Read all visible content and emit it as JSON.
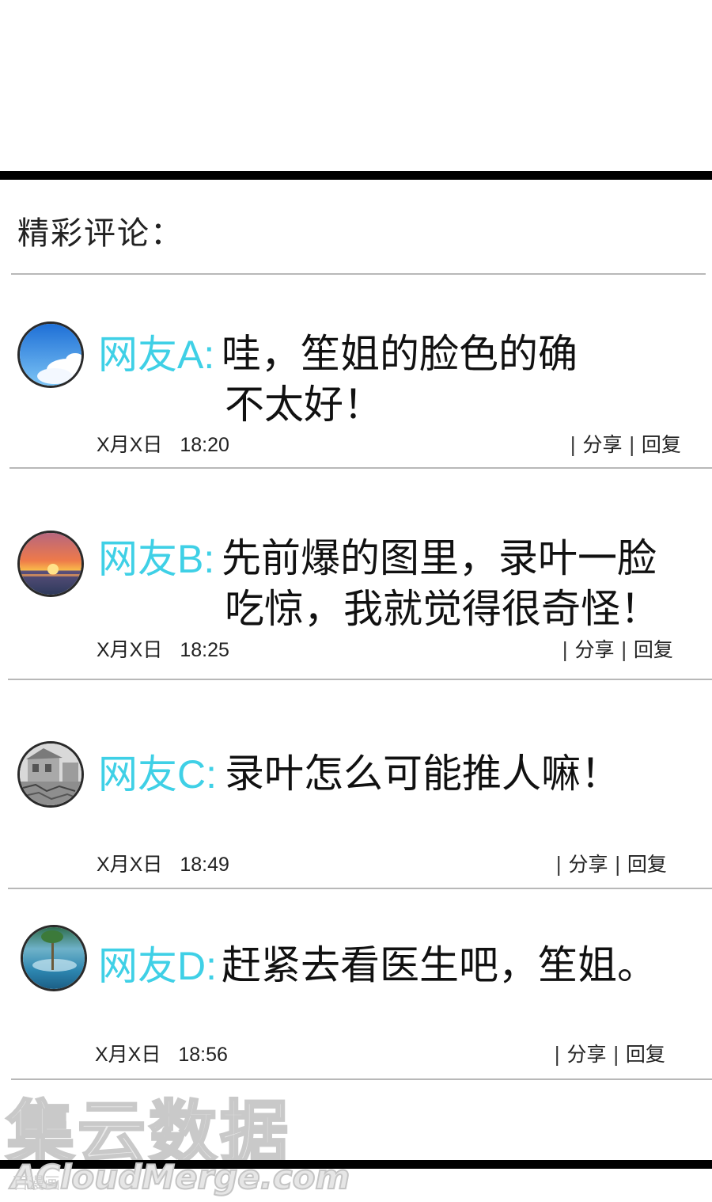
{
  "section_title": "精彩评论：",
  "comments": [
    {
      "user": "网友A:",
      "text_line1": "哇，笙姐的脸色的确",
      "text_line2": "不太好！",
      "date": "X月X日",
      "time": "18:20",
      "share_label": "分享",
      "reply_label": "回复",
      "avatar_icon": "sky-clouds-avatar"
    },
    {
      "user": "网友B:",
      "text_line1": "先前爆的图里，录叶一脸",
      "text_line2": "吃惊，我就觉得很奇怪！",
      "date": "X月X日",
      "time": "18:25",
      "share_label": "分享",
      "reply_label": "回复",
      "avatar_icon": "sunset-sea-avatar"
    },
    {
      "user": "网友C:",
      "text_line1": "录叶怎么可能推人嘛！",
      "date": "X月X日",
      "time": "18:49",
      "share_label": "分享",
      "reply_label": "回复",
      "avatar_icon": "ruins-sketch-avatar"
    },
    {
      "user": "网友D:",
      "text_line1": "赶紧去看医生吧，笙姐。",
      "date": "X月X日",
      "time": "18:56",
      "share_label": "分享",
      "reply_label": "回复",
      "avatar_icon": "lake-reflection-avatar"
    }
  ],
  "watermark": {
    "main": "集云数据",
    "sub": "ACloudMerge.com",
    "small": "百漫画"
  },
  "colors": {
    "username": "#3fd0e6",
    "text": "#111111",
    "divider": "#b8b8b8",
    "bar": "#000000"
  }
}
